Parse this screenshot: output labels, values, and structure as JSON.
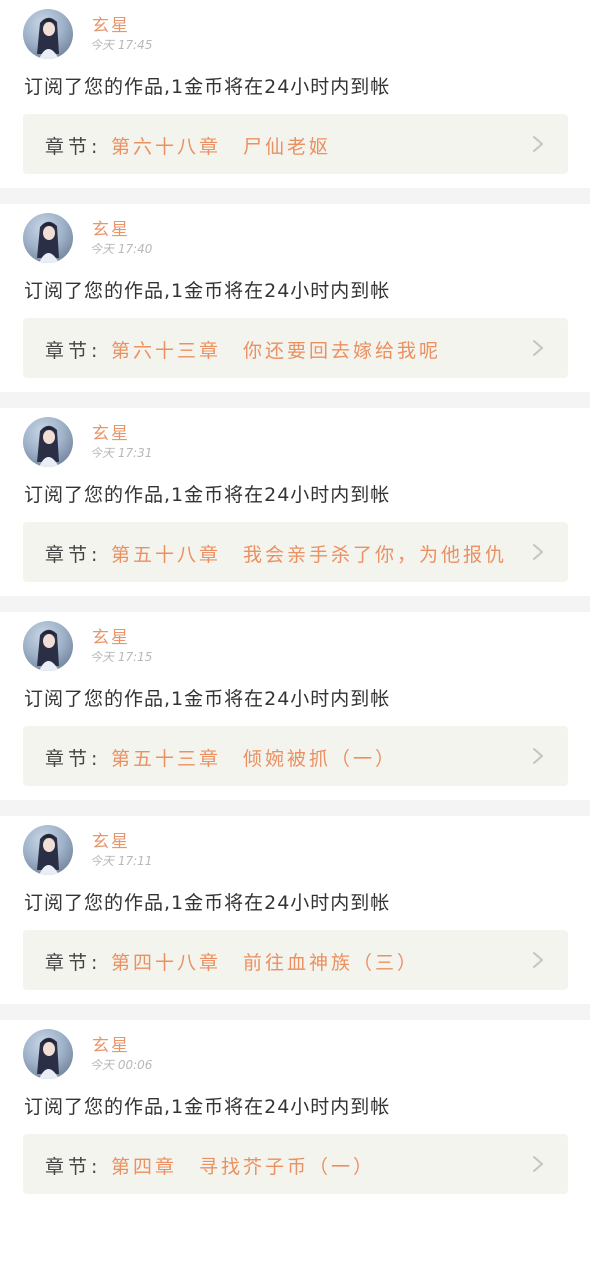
{
  "items": [
    {
      "username": "玄星",
      "time": "今天 17:45",
      "message": "订阅了您的作品,1金币将在24小时内到帐",
      "chapter_label": "章节:",
      "chapter_title": "第六十八章　尸仙老妪"
    },
    {
      "username": "玄星",
      "time": "今天 17:40",
      "message": "订阅了您的作品,1金币将在24小时内到帐",
      "chapter_label": "章节:",
      "chapter_title": "第六十三章　你还要回去嫁给我呢"
    },
    {
      "username": "玄星",
      "time": "今天 17:31",
      "message": "订阅了您的作品,1金币将在24小时内到帐",
      "chapter_label": "章节:",
      "chapter_title": "第五十八章　我会亲手杀了你，为他报仇"
    },
    {
      "username": "玄星",
      "time": "今天 17:15",
      "message": "订阅了您的作品,1金币将在24小时内到帐",
      "chapter_label": "章节:",
      "chapter_title": "第五十三章　倾婉被抓（一）"
    },
    {
      "username": "玄星",
      "time": "今天 17:11",
      "message": "订阅了您的作品,1金币将在24小时内到帐",
      "chapter_label": "章节:",
      "chapter_title": "第四十八章　前往血神族（三）"
    },
    {
      "username": "玄星",
      "time": "今天 00:06",
      "message": "订阅了您的作品,1金币将在24小时内到帐",
      "chapter_label": "章节:",
      "chapter_title": "第四章　寻找芥子币（一）"
    }
  ],
  "colors": {
    "accent": "#eb9060",
    "username": "#e8956b",
    "chapter_bg": "#f4f4ef",
    "separator": "#f4f4f4",
    "text": "#333333",
    "muted": "#b8b8b8"
  },
  "icons": {
    "avatar": "avatar-image",
    "chevron": "chevron-right-icon"
  }
}
